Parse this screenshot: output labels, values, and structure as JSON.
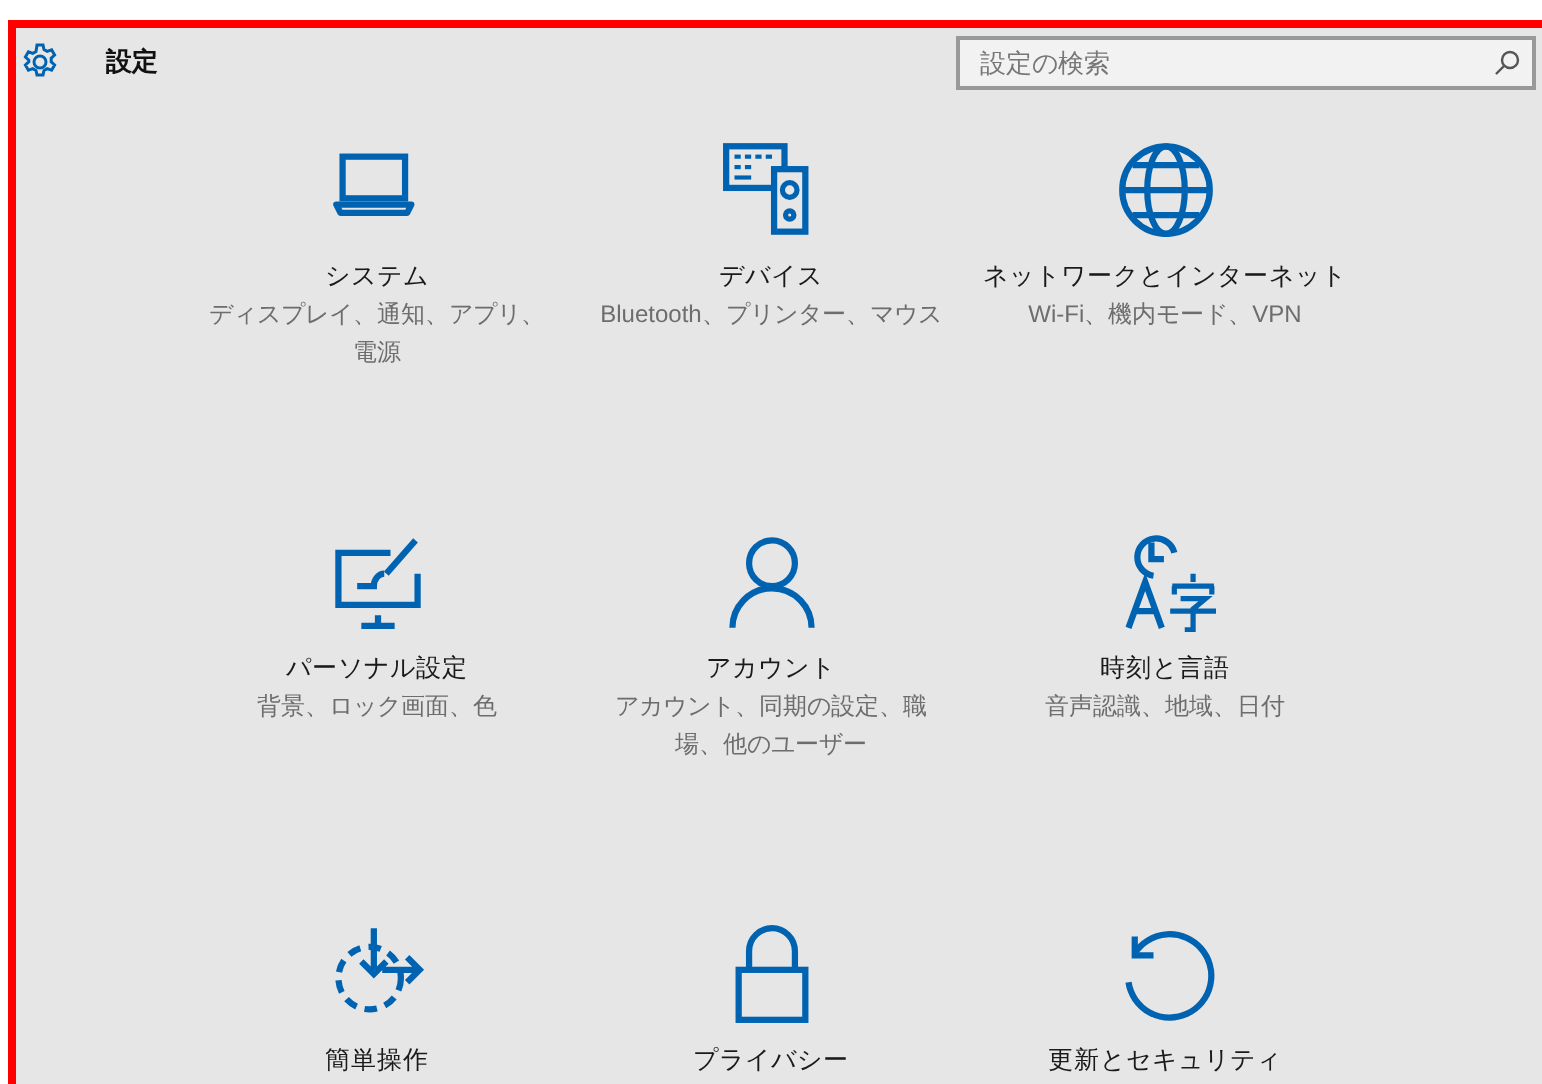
{
  "window": {
    "title": "設定"
  },
  "search": {
    "placeholder": "設定の検索"
  },
  "tiles": [
    {
      "title": "システム",
      "description": "ディスプレイ、通知、アプリ、電源"
    },
    {
      "title": "デバイス",
      "description": "Bluetooth、プリンター、マウス"
    },
    {
      "title": "ネットワークとインターネット",
      "description": "Wi-Fi、機内モード、VPN"
    },
    {
      "title": "パーソナル設定",
      "description": "背景、ロック画面、色"
    },
    {
      "title": "アカウント",
      "description": "アカウント、同期の設定、職場、他のユーザー"
    },
    {
      "title": "時刻と言語",
      "description": "音声認識、地域、日付"
    },
    {
      "title": "簡単操作"
    },
    {
      "title": "プライバシー"
    },
    {
      "title": "更新とセキュリティ"
    }
  ]
}
